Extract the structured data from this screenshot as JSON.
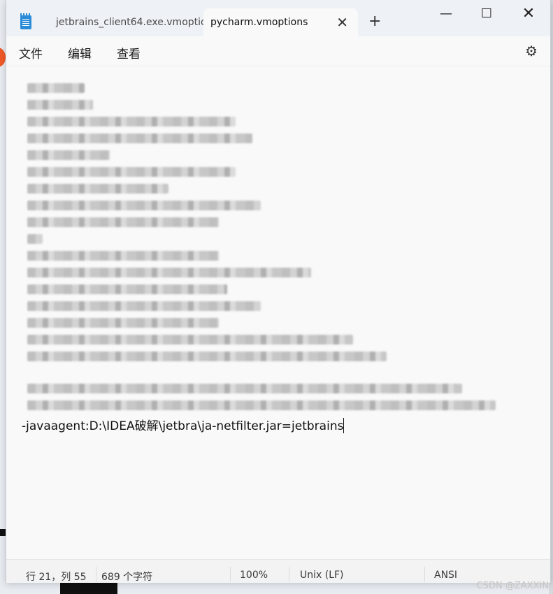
{
  "tabs": [
    {
      "label": "jetbrains_client64.exe.vmoptior",
      "active": false
    },
    {
      "label": "pycharm.vmoptions",
      "active": true
    }
  ],
  "menu": [
    "文件",
    "编辑",
    "查看"
  ],
  "editor": {
    "visible_line": "-javaagent:D:\\IDEA破解\\jetbra\\ja-netfilter.jar=jetbrains"
  },
  "status": {
    "position": "行 21，列 55",
    "char_count": "689 个字符",
    "zoom": "100%",
    "line_ending": "Unix (LF)",
    "encoding": "ANSI"
  },
  "watermark": "CSDN @ZAXXIN",
  "colors": {
    "accent_icon": "#2a8cd8",
    "window_bg": "#f9f9f9"
  }
}
